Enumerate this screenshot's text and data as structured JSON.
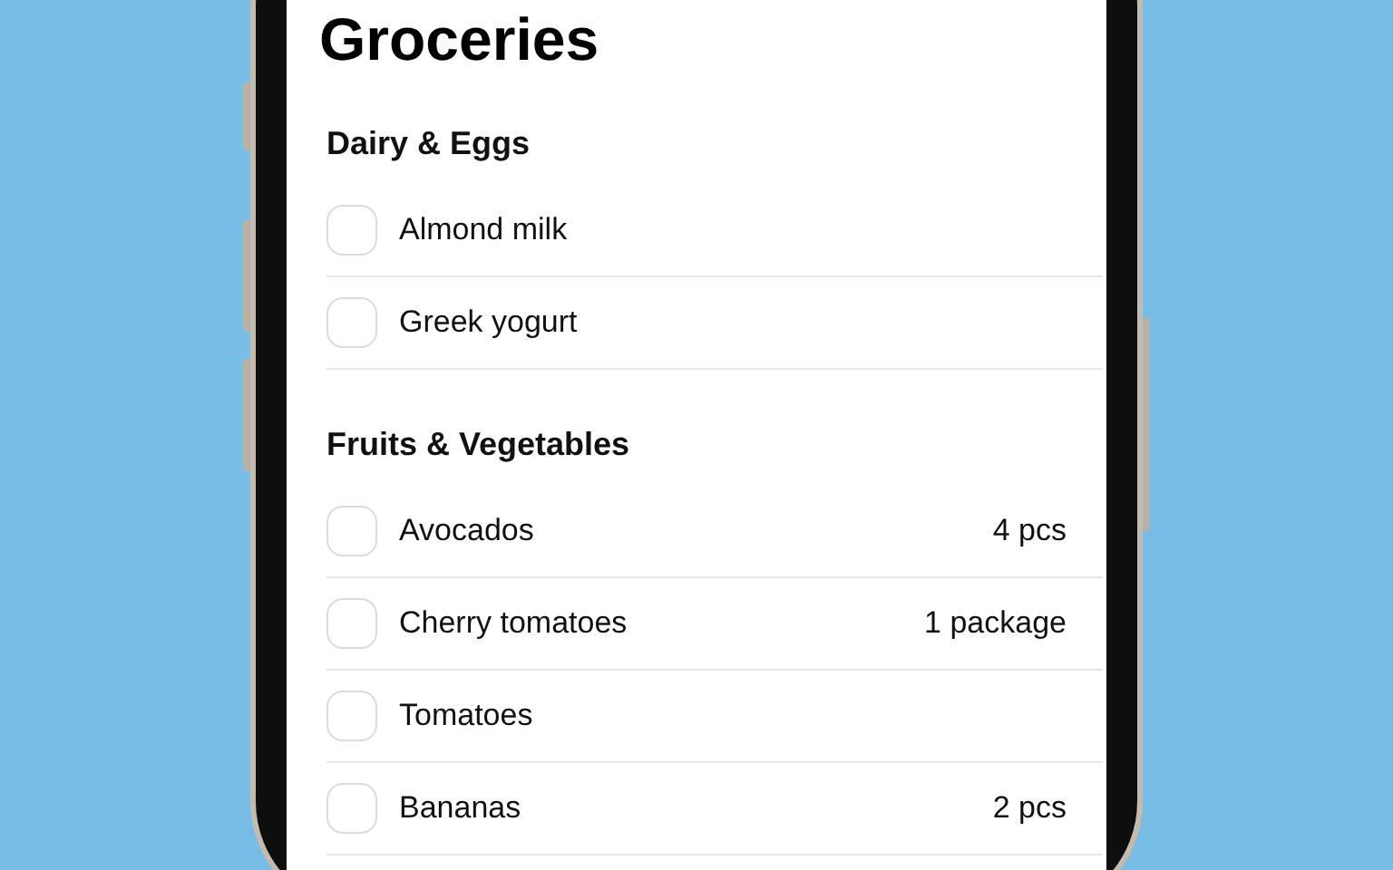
{
  "title": "Groceries",
  "sections": [
    {
      "name": "Dairy & Eggs",
      "items": [
        {
          "name": "Almond milk",
          "checked": false
        },
        {
          "name": "Greek yogurt",
          "checked": false
        }
      ]
    },
    {
      "name": "Fruits & Vegetables",
      "items": [
        {
          "name": "Avocados",
          "quantity": "4 pcs",
          "checked": false
        },
        {
          "name": "Cherry tomatoes",
          "quantity": "1 package",
          "checked": false
        },
        {
          "name": "Tomatoes",
          "checked": false
        },
        {
          "name": "Bananas",
          "quantity": "2 pcs",
          "checked": false
        }
      ]
    }
  ]
}
